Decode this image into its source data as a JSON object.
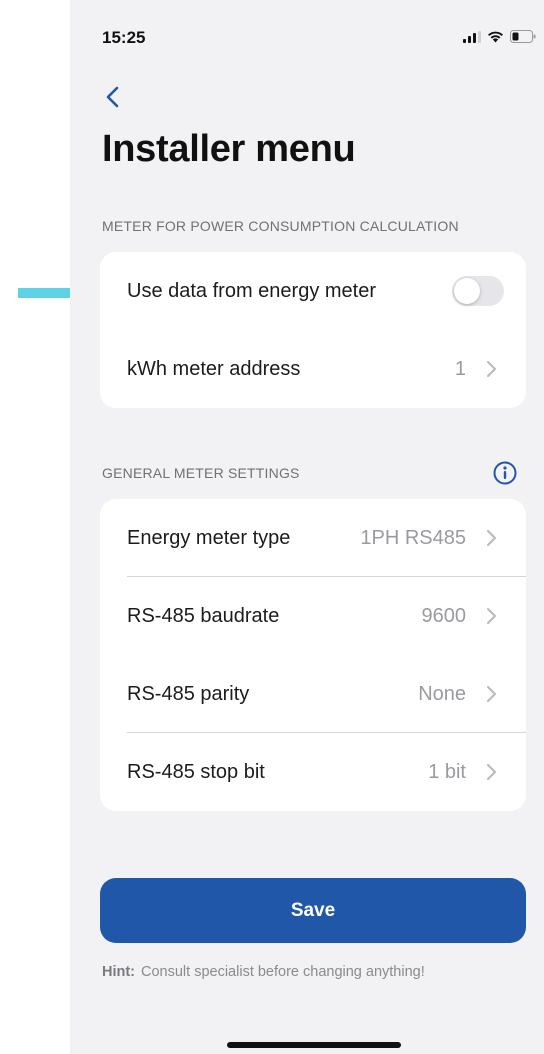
{
  "status_bar": {
    "time": "15:25",
    "icons": [
      "signal-icon",
      "wifi-icon",
      "battery-icon"
    ]
  },
  "header": {
    "back_icon": "chevron-left-icon",
    "title": "Installer menu"
  },
  "section_meter": {
    "header": "METER FOR POWER CONSUMPTION CALCULATION",
    "rows": [
      {
        "label": "Use data from energy meter",
        "toggle_on": false
      },
      {
        "label": "kWh meter address",
        "value": "1"
      }
    ]
  },
  "section_general": {
    "header": "GENERAL METER SETTINGS",
    "info_icon": "info-icon",
    "rows": [
      {
        "label": "Energy meter type",
        "value": "1PH RS485"
      },
      {
        "label": "RS-485 baudrate",
        "value": "9600"
      },
      {
        "label": "RS-485 parity",
        "value": "None"
      },
      {
        "label": "RS-485 stop bit",
        "value": "1 bit"
      }
    ]
  },
  "save_button": {
    "label": "Save"
  },
  "hint": {
    "label": "Hint:",
    "text": "Consult specialist before changing anything!"
  },
  "annotation_arrow": {
    "color": "#5fd3e6",
    "icon": "arrow-right-icon"
  },
  "colors": {
    "accent": "#2157a8",
    "background": "#f2f2f4",
    "card": "#ffffff",
    "secondary_text": "#9a9a9f"
  }
}
